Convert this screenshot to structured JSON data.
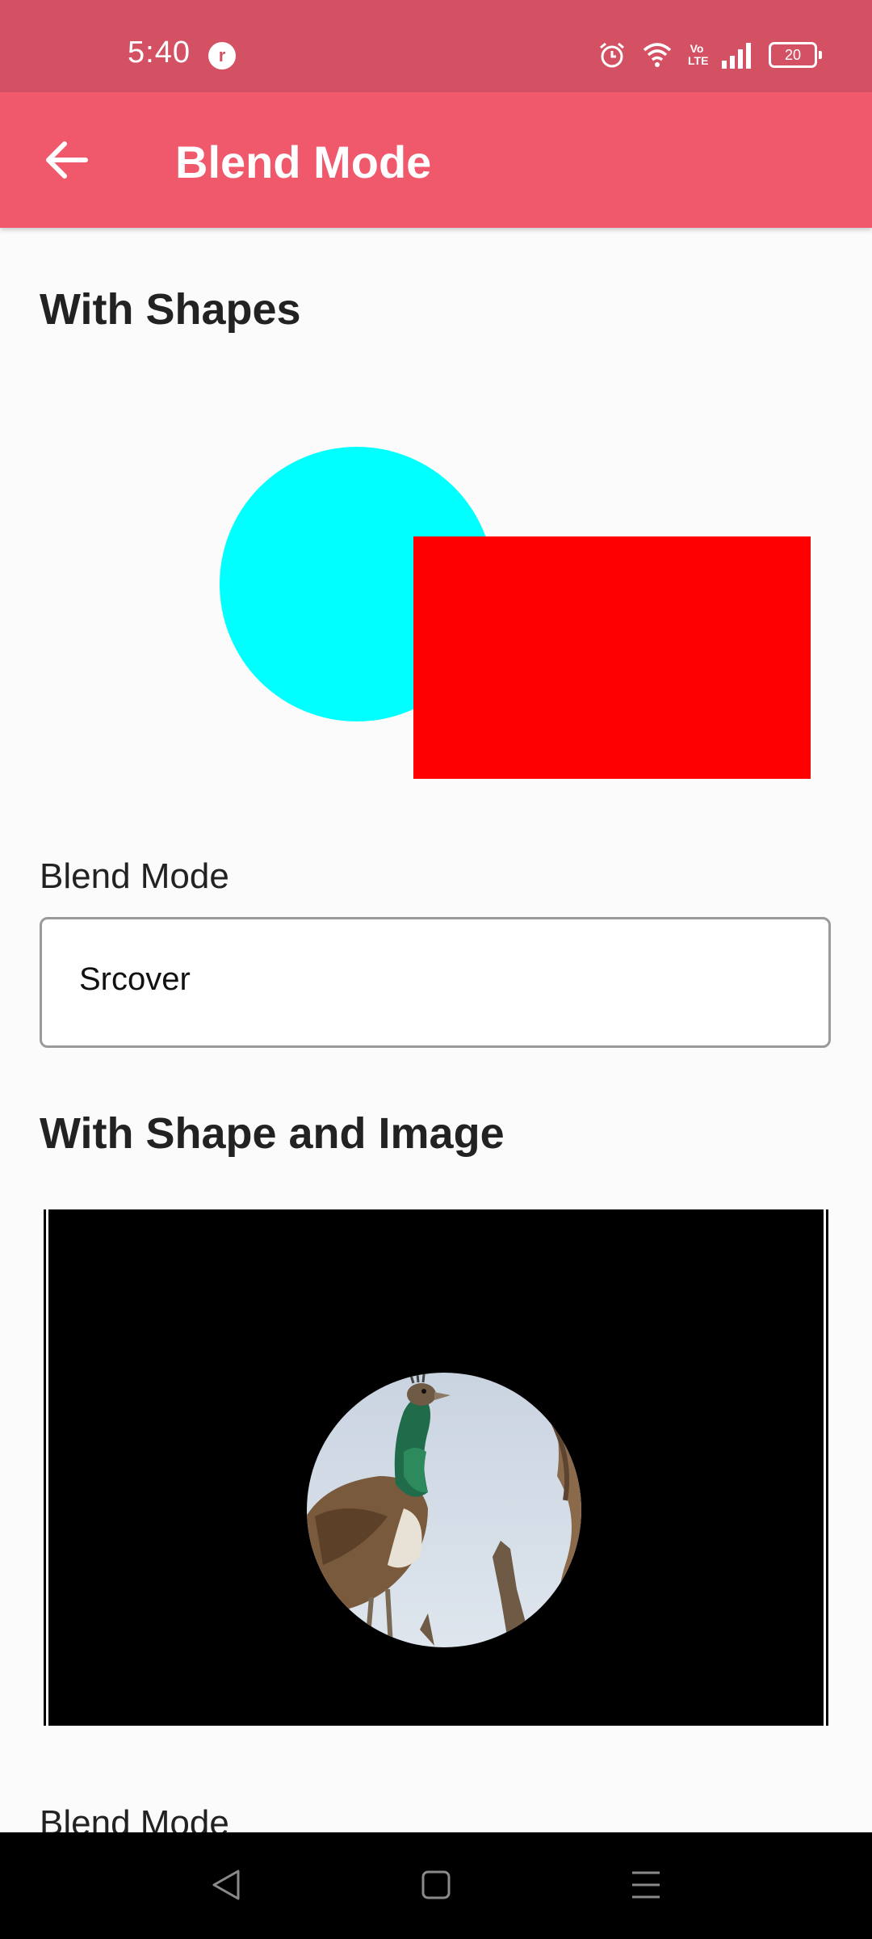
{
  "status_bar": {
    "time": "5:40",
    "app_icon_letter": "r",
    "battery_level": "20",
    "network_label": "Vo LTE"
  },
  "app_bar": {
    "title": "Blend Mode",
    "back_icon": "arrow-left-icon",
    "background_color": "#f0586b"
  },
  "sections": {
    "shapes": {
      "title": "With Shapes",
      "circle_color": "#00ffff",
      "rect_color": "#ff0000",
      "blend_label": "Blend Mode",
      "blend_value": "Srcover"
    },
    "shape_image": {
      "title": "With Shape and Image",
      "image_subject": "peacock",
      "blend_label": "Blend Mode"
    }
  },
  "nav_bar": {
    "back_icon": "triangle-back-icon",
    "home_icon": "square-home-icon",
    "menu_icon": "menu-lines-icon"
  }
}
